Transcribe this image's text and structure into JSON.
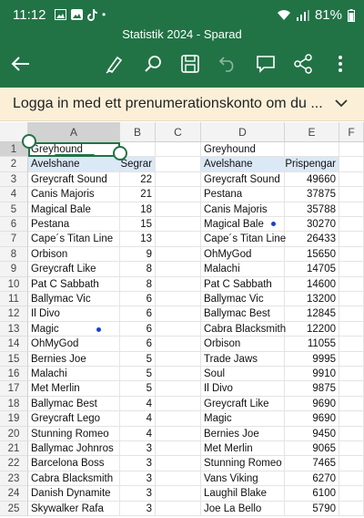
{
  "status": {
    "time": "11:12",
    "battery": "81%",
    "dot": "•"
  },
  "title": "Statistik 2024 - Sparad",
  "banner": {
    "text": "Logga in med ett prenumerationskonto om du ..."
  },
  "columns": [
    "A",
    "B",
    "C",
    "D",
    "E",
    "F"
  ],
  "rows": [
    {
      "n": "1",
      "a": "Greyhound",
      "b": "",
      "d": "Greyhound",
      "e": ""
    },
    {
      "n": "2",
      "a": "Avelshane",
      "b": "Segrar",
      "d": "Avelshane",
      "e": "Prispengar"
    },
    {
      "n": "3",
      "a": "Greycraft Sound",
      "b": "22",
      "d": "Greycraft Sound",
      "e": "49660"
    },
    {
      "n": "4",
      "a": "Canis Majoris",
      "b": "21",
      "d": "Pestana",
      "e": "37875"
    },
    {
      "n": "5",
      "a": "Magical Bale",
      "b": "18",
      "d": "Canis Majoris",
      "e": "35788"
    },
    {
      "n": "6",
      "a": "Pestana",
      "b": "15",
      "d": "Magical Bale",
      "e": "30270"
    },
    {
      "n": "7",
      "a": "Cape´s Titan Line",
      "b": "13",
      "d": "Cape´s Titan Line",
      "e": "26433"
    },
    {
      "n": "8",
      "a": "Orbison",
      "b": "9",
      "d": "OhMyGod",
      "e": "15650"
    },
    {
      "n": "9",
      "a": "Greycraft Like",
      "b": "8",
      "d": "Malachi",
      "e": "14705"
    },
    {
      "n": "10",
      "a": "Pat C Sabbath",
      "b": "8",
      "d": "Pat C Sabbath",
      "e": "14600"
    },
    {
      "n": "11",
      "a": "Ballymac Vic",
      "b": "6",
      "d": "Ballymac Vic",
      "e": "13200"
    },
    {
      "n": "12",
      "a": "Il Divo",
      "b": "6",
      "d": "Ballymac Best",
      "e": "12845"
    },
    {
      "n": "13",
      "a": "Magic",
      "b": "6",
      "d": "Cabra Blacksmith",
      "e": "12200"
    },
    {
      "n": "14",
      "a": "OhMyGod",
      "b": "6",
      "d": "Orbison",
      "e": "11055"
    },
    {
      "n": "15",
      "a": "Bernies Joe",
      "b": "5",
      "d": "Trade Jaws",
      "e": "9995"
    },
    {
      "n": "16",
      "a": "Malachi",
      "b": "5",
      "d": "Soul",
      "e": "9910"
    },
    {
      "n": "17",
      "a": "Met Merlin",
      "b": "5",
      "d": "Il Divo",
      "e": "9875"
    },
    {
      "n": "18",
      "a": "Ballymac Best",
      "b": "4",
      "d": "Greycraft Like",
      "e": "9690"
    },
    {
      "n": "19",
      "a": "Greycraft Lego",
      "b": "4",
      "d": "Magic",
      "e": "9690"
    },
    {
      "n": "20",
      "a": "Stunning Romeo",
      "b": "4",
      "d": "Bernies Joe",
      "e": "9450"
    },
    {
      "n": "21",
      "a": "Ballymac Johnros",
      "b": "3",
      "d": "Met Merlin",
      "e": "9065"
    },
    {
      "n": "22",
      "a": "Barcelona Boss",
      "b": "3",
      "d": "Stunning Romeo",
      "e": "7465"
    },
    {
      "n": "23",
      "a": "Cabra Blacksmith",
      "b": "3",
      "d": "Vans Viking",
      "e": "6270"
    },
    {
      "n": "24",
      "a": "Danish Dynamite",
      "b": "3",
      "d": "Laughil Blake",
      "e": "6100"
    },
    {
      "n": "25",
      "a": "Skywalker Rafa",
      "b": "3",
      "d": "Joe La Bello",
      "e": "5790"
    }
  ],
  "colors": {
    "accent": "#217346",
    "header_highlight": "#dbe8f6",
    "banner": "#fbf0d7"
  }
}
